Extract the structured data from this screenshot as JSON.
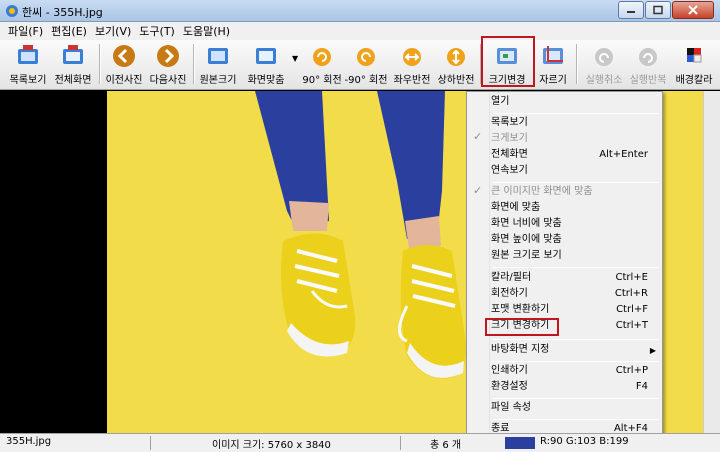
{
  "window": {
    "title": "한씨 - 355H.jpg"
  },
  "menubar": {
    "items": [
      "파일(F)",
      "편집(E)",
      "보기(V)",
      "도구(T)",
      "도움말(H)"
    ]
  },
  "toolbar": {
    "buttons": [
      {
        "label": "목록보기",
        "icon": "list-view-icon"
      },
      {
        "label": "전체화면",
        "icon": "fullscreen-icon"
      },
      {
        "label": "이전사진",
        "icon": "previous-arrow-icon"
      },
      {
        "label": "다음사진",
        "icon": "next-arrow-icon"
      },
      {
        "label": "원본크기",
        "icon": "original-size-icon"
      },
      {
        "label": "화면맞춤",
        "icon": "fit-screen-icon"
      },
      {
        "label": "90° 회전",
        "icon": "rotate-cw-icon"
      },
      {
        "label": "-90° 회전",
        "icon": "rotate-ccw-icon"
      },
      {
        "label": "좌우반전",
        "icon": "flip-horizontal-icon"
      },
      {
        "label": "상하반전",
        "icon": "flip-vertical-icon"
      },
      {
        "label": "크기변경",
        "icon": "resize-icon"
      },
      {
        "label": "자르기",
        "icon": "crop-icon"
      },
      {
        "label": "실행취소",
        "icon": "undo-icon"
      },
      {
        "label": "실행반복",
        "icon": "redo-icon"
      },
      {
        "label": "배경칼라",
        "icon": "background-color-icon"
      }
    ]
  },
  "context_menu": {
    "items": [
      {
        "label": "열기",
        "shortcut": ""
      },
      {
        "label": "목록보기",
        "shortcut": ""
      },
      {
        "label": "크게보기",
        "shortcut": ""
      },
      {
        "label": "전체화면",
        "shortcut": "Alt+Enter"
      },
      {
        "label": "연속보기",
        "shortcut": ""
      },
      {
        "label": "큰 이미지만 화면에 맞춤",
        "shortcut": ""
      },
      {
        "label": "화면에 맞춤",
        "shortcut": ""
      },
      {
        "label": "화면 너비에 맞춤",
        "shortcut": ""
      },
      {
        "label": "화면 높이에 맞춤",
        "shortcut": ""
      },
      {
        "label": "원본 크기로 보기",
        "shortcut": ""
      },
      {
        "label": "칼라/필터",
        "shortcut": "Ctrl+E"
      },
      {
        "label": "회전하기",
        "shortcut": "Ctrl+R"
      },
      {
        "label": "포맷 변환하기",
        "shortcut": "Ctrl+F"
      },
      {
        "label": "크기 변경하기",
        "shortcut": "Ctrl+T"
      },
      {
        "label": "바탕화면 지정",
        "shortcut": ""
      },
      {
        "label": "인쇄하기",
        "shortcut": "Ctrl+P"
      },
      {
        "label": "환경설정",
        "shortcut": "F4"
      },
      {
        "label": "파일 속성",
        "shortcut": ""
      },
      {
        "label": "종료",
        "shortcut": "Alt+F4"
      }
    ]
  },
  "statusbar": {
    "filename": "355H.jpg",
    "image_size": "이미지 크기: 5760 x 3840",
    "total": "총 6 개",
    "color_value": "R:90 G:103 B:199"
  },
  "colors": {
    "highlight": "#c0161e",
    "photo_bg": "#f3dc49",
    "denim": "#2a3f9e"
  }
}
